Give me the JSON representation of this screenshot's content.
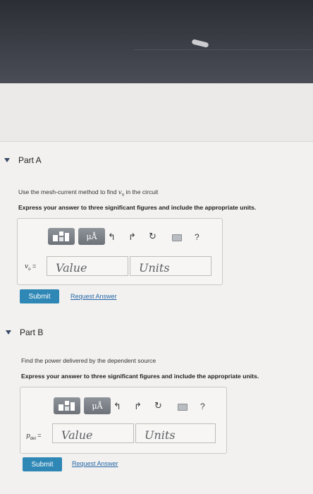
{
  "partA": {
    "title": "Part A",
    "text_prefix": "Use the mesh-current method to find ",
    "text_var": "v",
    "text_var_sub": "o",
    "text_suffix": " in the circuit",
    "instruction": "Express your answer to three significant figures and include the appropriate units.",
    "toolbar": {
      "units_symbol": "μÅ"
    },
    "var_label": "v",
    "var_sub": "o",
    "equals": "=",
    "value_placeholder": "Value",
    "units_placeholder": "Units",
    "submit_label": "Submit",
    "request_label": "Request Answer"
  },
  "partB": {
    "title": "Part B",
    "text": "Find the power delivered by the dependent source",
    "instruction": "Express your answer to three significant figures and include the appropriate units.",
    "toolbar": {
      "units_symbol": "μÅ"
    },
    "var_label": "p",
    "var_sub": "del",
    "equals": "=",
    "value_placeholder": "Value",
    "units_placeholder": "Units",
    "submit_label": "Submit",
    "request_label": "Request Answer"
  },
  "icons": {
    "collapse": "triangle-down",
    "templates": "templates-icon",
    "units": "mu-a-icon",
    "undo": "undo-icon",
    "redo": "redo-icon",
    "reset": "reset-icon",
    "keyboard": "keyboard-icon",
    "help": "help-icon"
  },
  "colors": {
    "submit": "#2e87b5",
    "link": "#2566a8",
    "toolbar_button": "#7d8289"
  }
}
